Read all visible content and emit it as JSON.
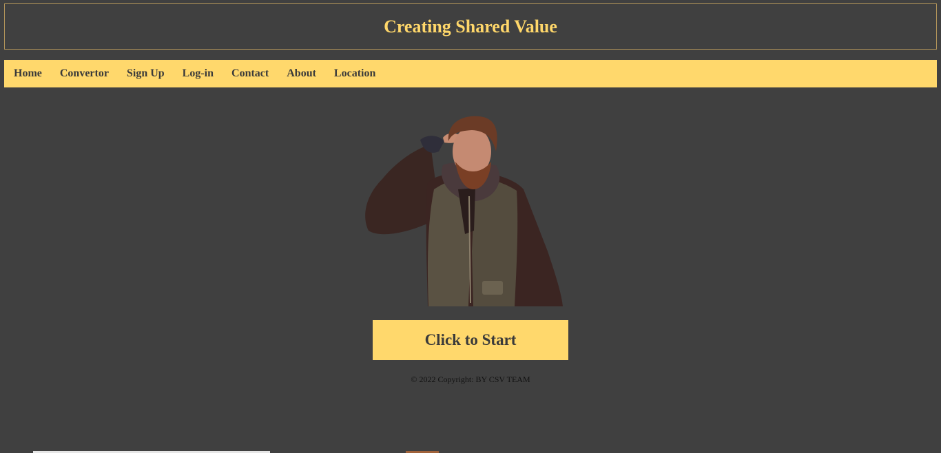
{
  "header": {
    "title": "Creating Shared Value"
  },
  "nav": {
    "items": [
      {
        "label": "Home"
      },
      {
        "label": "Convertor"
      },
      {
        "label": "Sign Up"
      },
      {
        "label": "Log-in"
      },
      {
        "label": "Contact"
      },
      {
        "label": "About"
      },
      {
        "label": "Location"
      }
    ]
  },
  "hero": {
    "start_label": "Click to Start"
  },
  "footer": {
    "text": "© 2022 Copyright: BY CSV TEAM"
  },
  "colors": {
    "background": "#404040",
    "accent": "#ffd86c",
    "text_dark": "#3a3a3a"
  }
}
